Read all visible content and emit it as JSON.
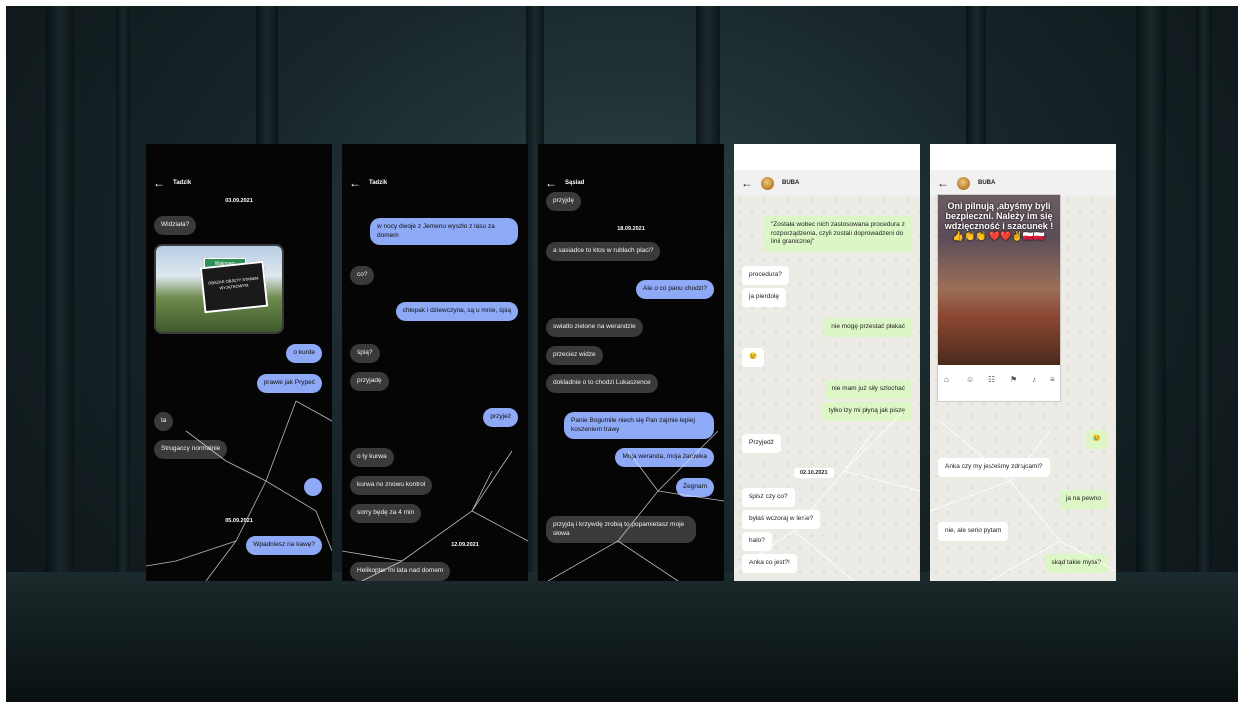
{
  "phones": [
    {
      "contact": "Tadzik",
      "date_top": "03.09.2021",
      "messages": [
        "Widziała?",
        "o kurde",
        "prawie jak Prypeć",
        "ta",
        "Strugaccy normalnie",
        "Wpadniesz na kawę?"
      ],
      "date_bottom": "05.09.2021",
      "photo_sign_top": "Wajnowo",
      "photo_sign_text": "OBSZAR OBJĘTY STANEM WYJĄTKOWYM"
    },
    {
      "contact": "Tadzik",
      "messages": [
        "w nocy dwoje z Jemenu wyszło z lasu za domem",
        "co?",
        "chłopak i dziewczyna, są u mnie, śpią",
        "śpią?",
        "przyjadę",
        "przyjeż",
        "o ty kurwa",
        "kurwa no znowu kontrol",
        "sorry będę za 4 min",
        "Helikopter mi lata nad domem"
      ],
      "date_bottom": "12.09.2021"
    },
    {
      "contact": "Sąsiad",
      "date_top": "18.09.2021",
      "messages": [
        "przyjdę",
        "a sasiadce to ktos w rublach placi?",
        "Ale o co panu chodzi?",
        "swiatlo zielone na werandzie",
        "przeciez widze",
        "dokladnie o to chodzi Lukaszence",
        "Panie Bogumile niech się Pan zajmie lepiej koszeniem trawy",
        "Moja weranda, moja żarówka",
        "Żegnam",
        "przyjdą i krzywdę zrobią to popamietasz moje słowa"
      ]
    },
    {
      "contact": "BUBA",
      "quote": "\"Została wobec nich zastosowana procedura z rozporządzenia, czyli zostali doprowadzeni do linii granicznej\"",
      "messages": [
        "procedura?",
        "ja pierdolę",
        "nie mogę przestać płakać",
        "😢",
        "nie mam już siły szlochać",
        "tylko łzy mi płyną jak piszę",
        "Przyjedź",
        "śpisz czy co?",
        "byłaś wczoraj w lesie?",
        "halo?",
        "Anka co jest?!"
      ],
      "date_mid": "02.10.2021"
    },
    {
      "contact": "BUBA",
      "post_title": "Oni pilnują ,abyśmy byli bezpieczni. Należy im się wdzięczność i szacunek !👍👏👏 ❤️❤️✌️🇵🇱🇵🇱",
      "messages": [
        "😢",
        "Anka czy my jesteśmy zdrajcami?",
        "ja na pewno",
        "nie, ale serio pytam",
        "skąd takie myśli?"
      ]
    }
  ]
}
